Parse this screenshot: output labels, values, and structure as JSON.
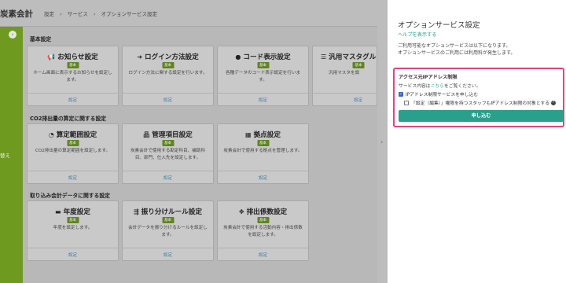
{
  "app": {
    "brand": "炭素会計",
    "breadcrumb": [
      "設定",
      "›",
      "サービス",
      "›",
      "オプションサービス設定"
    ],
    "sidebar_label": "替え"
  },
  "sections": [
    {
      "title": "基本設定"
    },
    {
      "title": "CO2排出量の算定に関する設定"
    },
    {
      "title": "取り込み会計データに関する設定"
    }
  ],
  "cards": [
    {
      "icon": "megaphone-icon",
      "glyph": "📢",
      "title": "お知らせ設定",
      "badge": "基本",
      "desc": "ホーム画面に表示するお知らせを設定します。",
      "link": "設定"
    },
    {
      "icon": "login-icon",
      "glyph": "➜",
      "title": "ログイン方法設定",
      "badge": "基本",
      "desc": "ログイン方法に関する設定を行います。",
      "link": "設定"
    },
    {
      "icon": "code-icon",
      "glyph": "●",
      "title": "コード表示設定",
      "badge": "基本",
      "desc": "各種データのコード表示設定を行います。",
      "link": "設定"
    },
    {
      "icon": "list-icon",
      "glyph": "☰",
      "title": "汎用マスタグル",
      "badge": "基本",
      "desc": "汎用マスタを設",
      "link": "設定"
    },
    {
      "icon": "pie-chart-icon",
      "glyph": "◔",
      "title": "算定範囲設定",
      "badge": "基本",
      "desc": "CO2排出量の算定範囲を設定します。",
      "link": "設定"
    },
    {
      "icon": "org-icon",
      "glyph": "品",
      "title": "管理項目設定",
      "badge": "基本",
      "desc": "炭素会計で使用する勘定科目、補助科目、部門、仕入先を設定します。",
      "link": "設定"
    },
    {
      "icon": "building-icon",
      "glyph": "▦",
      "title": "拠点設定",
      "badge": "基本",
      "desc": "炭素会計で使用する拠点を管理します。",
      "link": "設定"
    },
    {
      "icon": "calendar-icon",
      "glyph": "▬",
      "title": "年度設定",
      "badge": "基本",
      "desc": "年度を設定します。",
      "link": "設定"
    },
    {
      "icon": "split-icon",
      "glyph": "⇶",
      "title": "振り分けルール設定",
      "badge": "基本",
      "desc": "会計データを振り分けるルールを設定します。",
      "link": "設定"
    },
    {
      "icon": "grid-icon",
      "glyph": "✥",
      "title": "排出係数設定",
      "badge": "基本",
      "desc": "炭素会計で使用する活動内容・排出係数を設定します。",
      "link": "設定"
    }
  ],
  "panel": {
    "title": "オプションサービス設定",
    "help_link": "ヘルプを表示する",
    "note_line1": "ご利用可能なオプションサービスは以下になります。",
    "note_line2": "オプションサービスのご利用には利用料が発生します。",
    "option": {
      "title": "アクセス元IPアドレス制限",
      "sub_prefix": "サービス内容は",
      "sub_link": "こちら",
      "sub_suffix": "をご覧ください。",
      "check1_label": "IPアドレス制限サービスを申し込む",
      "check1_checked": true,
      "check2_label": "「設定（編集）」権限を持つスタッフもIPアドレス制限の対象とする",
      "check2_checked": false,
      "apply_label": "申し込む"
    }
  },
  "colors": {
    "accent": "#2aa08c",
    "highlight_border": "#e0477a",
    "sidebar": "#6e9a1f",
    "badge": "#5e8520"
  }
}
